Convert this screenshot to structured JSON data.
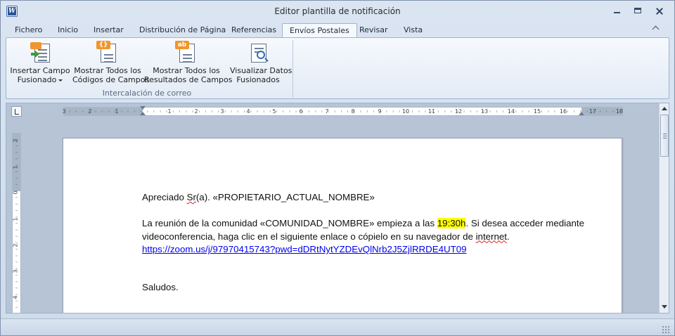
{
  "window": {
    "title": "Editor plantilla de notificación",
    "app_icon_letter": "W"
  },
  "tabs": [
    {
      "label": "Fichero",
      "active": false
    },
    {
      "label": "Inicio",
      "active": false
    },
    {
      "label": "Insertar",
      "active": false
    },
    {
      "label": "Distribución de Página",
      "active": false
    },
    {
      "label": "Referencias",
      "active": false
    },
    {
      "label": "Envíos Postales",
      "active": true
    },
    {
      "label": "Revisar",
      "active": false
    },
    {
      "label": "Vista",
      "active": false
    }
  ],
  "ribbon": {
    "group_label": "Intercalación de correo",
    "buttons": [
      {
        "line1": "Insertar Campo",
        "line2": "Fusionado",
        "has_dropdown": true,
        "icon": "insert-field-icon"
      },
      {
        "line1": "Mostrar Todos los",
        "line2": "Códigos de Campos",
        "has_dropdown": false,
        "icon": "field-codes-icon",
        "tag": "{}"
      },
      {
        "line1": "Mostrar Todos los",
        "line2": "Resultados de Campos",
        "has_dropdown": false,
        "icon": "field-results-icon",
        "tag": "ab"
      },
      {
        "line1": "Visualizar Datos",
        "line2": "Fusionados",
        "has_dropdown": false,
        "icon": "preview-merged-icon"
      }
    ]
  },
  "ruler": {
    "h_numbers_left": [
      "3",
      "2",
      "1"
    ],
    "h_numbers_right": [
      "1",
      "2",
      "3",
      "4",
      "5",
      "6",
      "7",
      "8",
      "9",
      "10",
      "11",
      "12",
      "13",
      "14",
      "15",
      "16",
      "17",
      "18"
    ],
    "v_numbers": [
      "2",
      "1",
      "0",
      "1",
      "2",
      "3",
      "4"
    ]
  },
  "document": {
    "greeting_prefix": "Apreciado ",
    "greeting_word": "Sr",
    "greeting_rest": "(a). «PROPIETARIO_ACTUAL_NOMBRE»",
    "para1_start": "La reunión de la comunidad «COMUNIDAD_NOMBRE» empieza a las ",
    "para1_time": "19:30h",
    "para1_after_time": ". Si desea acceder mediante",
    "para1_line2_start": "videoconferencia, haga clic en el siguiente enlace o cópielo en su navegador de ",
    "para1_line2_word": "internet",
    "para1_line2_end": ".",
    "link": "https://zoom.us/j/97970415743?pwd=dDRtNytYZDEvQlNrb2J5ZjlRRDE4UT09",
    "closing": "Saludos."
  },
  "colors": {
    "highlight": "#ffff00",
    "link": "#0000ee",
    "accent_orange": "#f0962c"
  }
}
